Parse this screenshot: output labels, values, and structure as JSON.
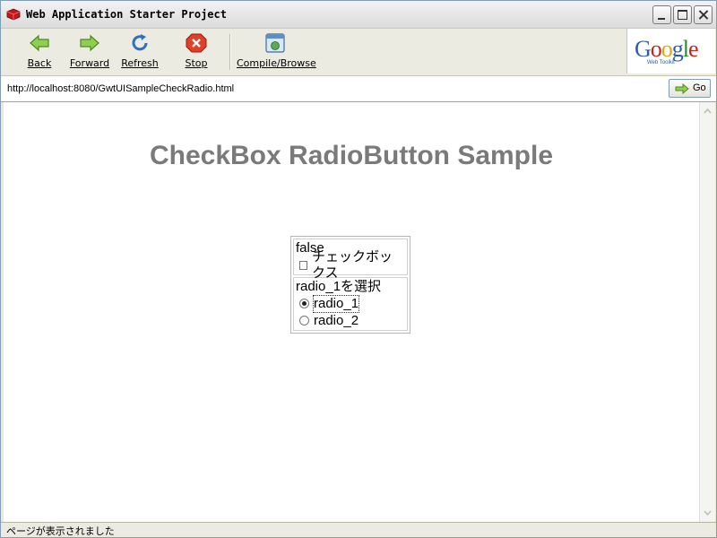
{
  "window": {
    "title": "Web Application Starter Project"
  },
  "toolbar": {
    "buttons": [
      {
        "label": "Back",
        "icon": "back-arrow-icon"
      },
      {
        "label": "Forward",
        "icon": "forward-arrow-icon"
      },
      {
        "label": "Refresh",
        "icon": "refresh-icon"
      },
      {
        "label": "Stop",
        "icon": "stop-icon"
      },
      {
        "label": "Compile/Browse",
        "icon": "compile-browse-icon"
      }
    ],
    "logo": {
      "brand": "Google",
      "sub": "Web Toolkit"
    }
  },
  "address": {
    "url": "http://localhost:8080/GwtUISampleCheckRadio.html",
    "go_label": "Go"
  },
  "page": {
    "title": "CheckBox RadioButton Sample",
    "checkbox_status": "false",
    "checkbox_label": "チェックボックス",
    "checkbox_checked": false,
    "radio_status": "radio_1を選択",
    "radios": [
      {
        "label": "radio_1",
        "checked": true
      },
      {
        "label": "radio_2",
        "checked": false
      }
    ]
  },
  "status": {
    "text": "ページが表示されました"
  },
  "colors": {
    "title_gray": "#7a7a7a",
    "chrome": "#ecebe2"
  }
}
